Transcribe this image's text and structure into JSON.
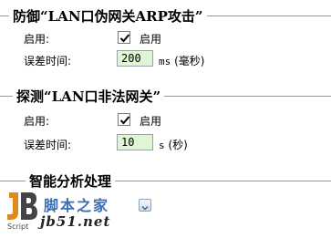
{
  "sections": [
    {
      "title": "防御“LAN口伪网关ARP攻击”",
      "enable_label": "启用:",
      "enable_checked": true,
      "enable_text": "启用",
      "delay_label": "误差时间:",
      "delay_value": "200",
      "delay_unit_code": "ms",
      "delay_unit_text": "(毫秒)"
    },
    {
      "title": "探测“LAN口非法网关”",
      "enable_label": "启用:",
      "enable_checked": true,
      "enable_text": "启用",
      "delay_label": "误差时间:",
      "delay_value": "10",
      "delay_unit_code": "s",
      "delay_unit_text": "(秒)"
    },
    {
      "title": "智能分析处理"
    }
  ],
  "watermark": {
    "brand_cn": "脚本之家",
    "site": "jb51.net",
    "script_label": "Script",
    "logo_letters": "JB"
  },
  "icons": {
    "check": "checkmark-icon",
    "dropdown": "chevron-down-icon"
  },
  "colors": {
    "input_bg": "#dff5d4",
    "divider": "#9a9a9a",
    "brand_blue": "#3b6fb5"
  }
}
